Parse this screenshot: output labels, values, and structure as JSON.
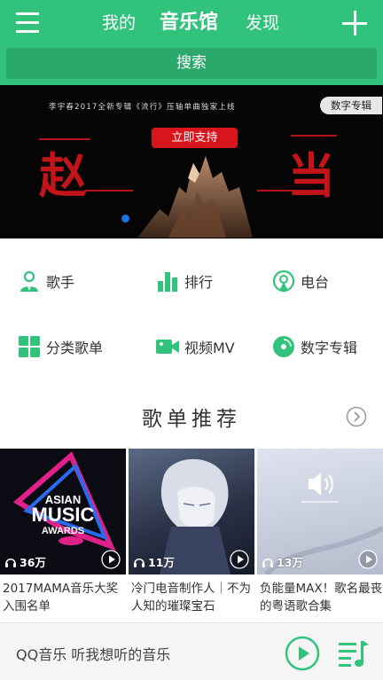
{
  "header": {
    "tabs": [
      {
        "label": "我的"
      },
      {
        "label": "音乐馆"
      },
      {
        "label": "发现"
      }
    ],
    "search_label": "搜索"
  },
  "banner": {
    "tagline": "李宇春2017全新专辑《流行》压轴单曲独家上线",
    "badge": "数字专辑",
    "cta": "立即支持",
    "calligraphy_left": "赵",
    "calligraphy_right": "当",
    "dots_total": 1,
    "active_dot": 1
  },
  "categories": [
    {
      "label": "歌手",
      "icon": "singer-icon"
    },
    {
      "label": "排行",
      "icon": "bar-chart-icon"
    },
    {
      "label": "电台",
      "icon": "radio-icon"
    },
    {
      "label": "分类歌单",
      "icon": "grid-icon"
    },
    {
      "label": "视频MV",
      "icon": "video-camera-icon"
    },
    {
      "label": "数字专辑",
      "icon": "disc-icon"
    }
  ],
  "section": {
    "title": "歌单推荐"
  },
  "playlists": [
    {
      "count": "36万",
      "title": "2017MAMA音乐大奖入围名单"
    },
    {
      "count": "11万",
      "title": "冷门电音制作人｜不为人知的璀璨宝石"
    },
    {
      "count": "13万",
      "title": "负能量MAX！歌名最丧的粤语歌合集"
    }
  ],
  "player": {
    "text": "QQ音乐 听我想听的音乐"
  },
  "colors": {
    "brand_green": "#31c27c",
    "banner_red": "#d8141c"
  }
}
